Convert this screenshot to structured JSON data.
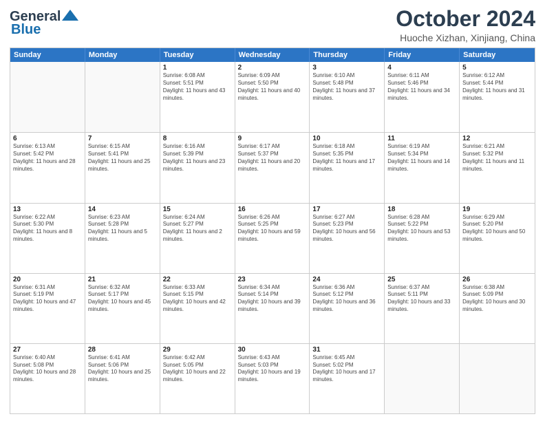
{
  "header": {
    "logo_line1": "General",
    "logo_line2": "Blue",
    "month": "October 2024",
    "location": "Huoche Xizhan, Xinjiang, China"
  },
  "days_of_week": [
    "Sunday",
    "Monday",
    "Tuesday",
    "Wednesday",
    "Thursday",
    "Friday",
    "Saturday"
  ],
  "weeks": [
    [
      {
        "day": "",
        "info": "",
        "empty": true
      },
      {
        "day": "",
        "info": "",
        "empty": true
      },
      {
        "day": "1",
        "info": "Sunrise: 6:08 AM\nSunset: 5:51 PM\nDaylight: 11 hours and 43 minutes."
      },
      {
        "day": "2",
        "info": "Sunrise: 6:09 AM\nSunset: 5:50 PM\nDaylight: 11 hours and 40 minutes."
      },
      {
        "day": "3",
        "info": "Sunrise: 6:10 AM\nSunset: 5:48 PM\nDaylight: 11 hours and 37 minutes."
      },
      {
        "day": "4",
        "info": "Sunrise: 6:11 AM\nSunset: 5:46 PM\nDaylight: 11 hours and 34 minutes."
      },
      {
        "day": "5",
        "info": "Sunrise: 6:12 AM\nSunset: 5:44 PM\nDaylight: 11 hours and 31 minutes."
      }
    ],
    [
      {
        "day": "6",
        "info": "Sunrise: 6:13 AM\nSunset: 5:42 PM\nDaylight: 11 hours and 28 minutes."
      },
      {
        "day": "7",
        "info": "Sunrise: 6:15 AM\nSunset: 5:41 PM\nDaylight: 11 hours and 25 minutes."
      },
      {
        "day": "8",
        "info": "Sunrise: 6:16 AM\nSunset: 5:39 PM\nDaylight: 11 hours and 23 minutes."
      },
      {
        "day": "9",
        "info": "Sunrise: 6:17 AM\nSunset: 5:37 PM\nDaylight: 11 hours and 20 minutes."
      },
      {
        "day": "10",
        "info": "Sunrise: 6:18 AM\nSunset: 5:35 PM\nDaylight: 11 hours and 17 minutes."
      },
      {
        "day": "11",
        "info": "Sunrise: 6:19 AM\nSunset: 5:34 PM\nDaylight: 11 hours and 14 minutes."
      },
      {
        "day": "12",
        "info": "Sunrise: 6:21 AM\nSunset: 5:32 PM\nDaylight: 11 hours and 11 minutes."
      }
    ],
    [
      {
        "day": "13",
        "info": "Sunrise: 6:22 AM\nSunset: 5:30 PM\nDaylight: 11 hours and 8 minutes."
      },
      {
        "day": "14",
        "info": "Sunrise: 6:23 AM\nSunset: 5:28 PM\nDaylight: 11 hours and 5 minutes."
      },
      {
        "day": "15",
        "info": "Sunrise: 6:24 AM\nSunset: 5:27 PM\nDaylight: 11 hours and 2 minutes."
      },
      {
        "day": "16",
        "info": "Sunrise: 6:26 AM\nSunset: 5:25 PM\nDaylight: 10 hours and 59 minutes."
      },
      {
        "day": "17",
        "info": "Sunrise: 6:27 AM\nSunset: 5:23 PM\nDaylight: 10 hours and 56 minutes."
      },
      {
        "day": "18",
        "info": "Sunrise: 6:28 AM\nSunset: 5:22 PM\nDaylight: 10 hours and 53 minutes."
      },
      {
        "day": "19",
        "info": "Sunrise: 6:29 AM\nSunset: 5:20 PM\nDaylight: 10 hours and 50 minutes."
      }
    ],
    [
      {
        "day": "20",
        "info": "Sunrise: 6:31 AM\nSunset: 5:19 PM\nDaylight: 10 hours and 47 minutes."
      },
      {
        "day": "21",
        "info": "Sunrise: 6:32 AM\nSunset: 5:17 PM\nDaylight: 10 hours and 45 minutes."
      },
      {
        "day": "22",
        "info": "Sunrise: 6:33 AM\nSunset: 5:15 PM\nDaylight: 10 hours and 42 minutes."
      },
      {
        "day": "23",
        "info": "Sunrise: 6:34 AM\nSunset: 5:14 PM\nDaylight: 10 hours and 39 minutes."
      },
      {
        "day": "24",
        "info": "Sunrise: 6:36 AM\nSunset: 5:12 PM\nDaylight: 10 hours and 36 minutes."
      },
      {
        "day": "25",
        "info": "Sunrise: 6:37 AM\nSunset: 5:11 PM\nDaylight: 10 hours and 33 minutes."
      },
      {
        "day": "26",
        "info": "Sunrise: 6:38 AM\nSunset: 5:09 PM\nDaylight: 10 hours and 30 minutes."
      }
    ],
    [
      {
        "day": "27",
        "info": "Sunrise: 6:40 AM\nSunset: 5:08 PM\nDaylight: 10 hours and 28 minutes."
      },
      {
        "day": "28",
        "info": "Sunrise: 6:41 AM\nSunset: 5:06 PM\nDaylight: 10 hours and 25 minutes."
      },
      {
        "day": "29",
        "info": "Sunrise: 6:42 AM\nSunset: 5:05 PM\nDaylight: 10 hours and 22 minutes."
      },
      {
        "day": "30",
        "info": "Sunrise: 6:43 AM\nSunset: 5:03 PM\nDaylight: 10 hours and 19 minutes."
      },
      {
        "day": "31",
        "info": "Sunrise: 6:45 AM\nSunset: 5:02 PM\nDaylight: 10 hours and 17 minutes."
      },
      {
        "day": "",
        "info": "",
        "empty": true
      },
      {
        "day": "",
        "info": "",
        "empty": true
      }
    ]
  ]
}
